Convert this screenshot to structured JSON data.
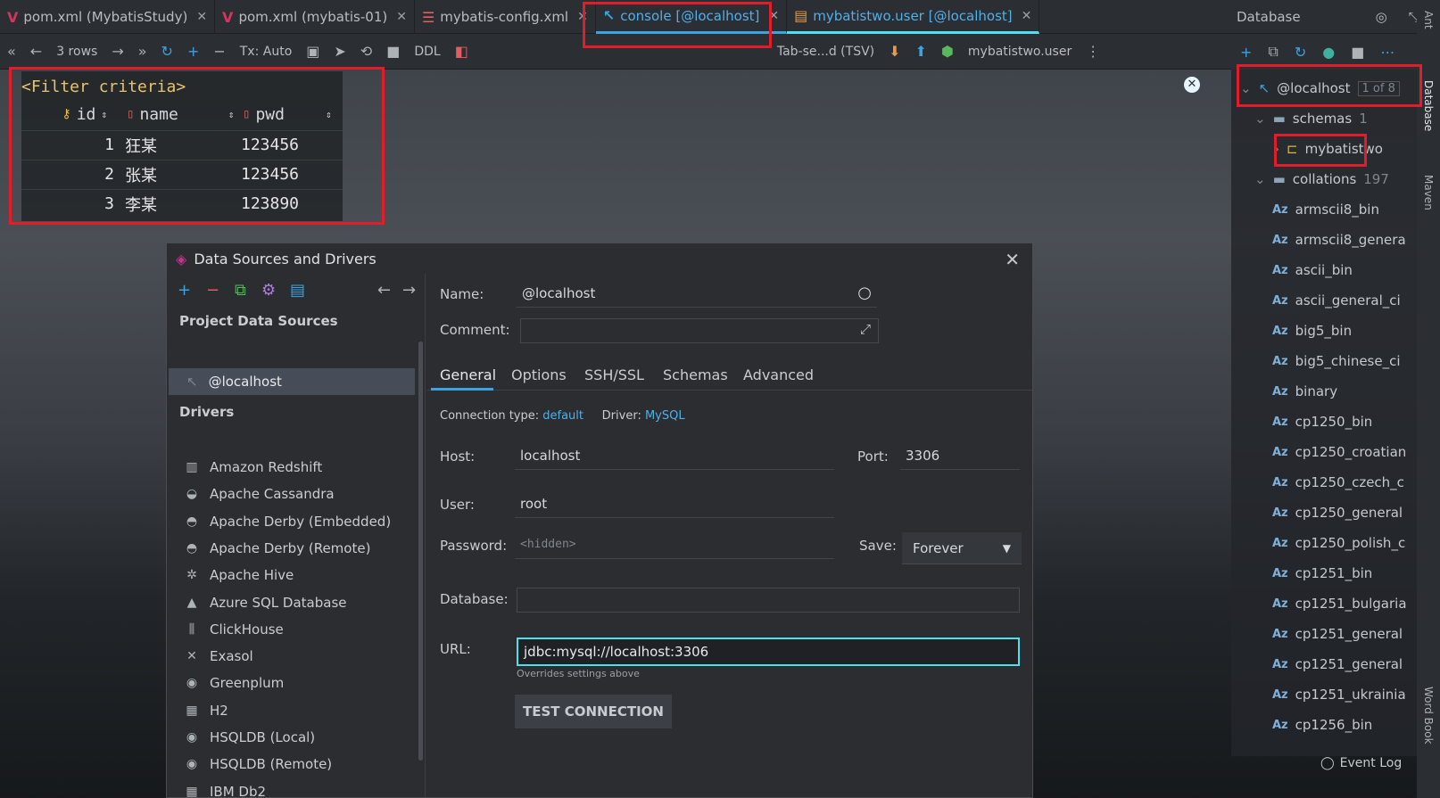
{
  "tabs": [
    {
      "label": "pom.xml (MybatisStudy)",
      "icon": "maven-icon"
    },
    {
      "label": "pom.xml (mybatis-01)",
      "icon": "maven-icon"
    },
    {
      "label": "mybatis-config.xml",
      "icon": "xml-icon"
    },
    {
      "label": "console [@localhost]",
      "icon": "console-icon"
    },
    {
      "label": "mybatistwo.user [@localhost]",
      "icon": "table-icon"
    }
  ],
  "database_panel": {
    "title": "Database"
  },
  "toolbar": {
    "rows": "3 rows",
    "tx": "Tx: Auto",
    "ddl": "DDL",
    "export_format": "Tab-se...d (TSV)",
    "target": "mybatistwo.user"
  },
  "grid": {
    "filter": "<Filter criteria>",
    "columns": [
      "id",
      "name",
      "pwd"
    ],
    "rows": [
      [
        "1",
        "狂某",
        "123456"
      ],
      [
        "2",
        "张某",
        "123456"
      ],
      [
        "3",
        "李某",
        "123890"
      ]
    ]
  },
  "tree": {
    "root": "@localhost",
    "root_count": "1 of 8",
    "schemas": "schemas",
    "schemas_count": "1",
    "schema": "mybatistwo",
    "collations": "collations",
    "collations_count": "197",
    "items": [
      "armscii8_bin",
      "armscii8_genera",
      "ascii_bin",
      "ascii_general_ci",
      "big5_bin",
      "big5_chinese_ci",
      "binary",
      "cp1250_bin",
      "cp1250_croatian",
      "cp1250_czech_c",
      "cp1250_general",
      "cp1250_polish_c",
      "cp1251_bin",
      "cp1251_bulgaria",
      "cp1251_general",
      "cp1251_general",
      "cp1251_ukrainia",
      "cp1256_bin"
    ]
  },
  "sidebar": {
    "ant": "Ant",
    "database": "Database",
    "maven": "Maven",
    "wordbook": "Word Book"
  },
  "event_log": "Event Log",
  "dialog": {
    "title": "Data Sources and Drivers",
    "project_sources_header": "Project Data Sources",
    "selected_source": "@localhost",
    "drivers_header": "Drivers",
    "drivers": [
      "Amazon Redshift",
      "Apache Cassandra",
      "Apache Derby (Embedded)",
      "Apache Derby (Remote)",
      "Apache Hive",
      "Azure SQL Database",
      "ClickHouse",
      "Exasol",
      "Greenplum",
      "H2",
      "HSQLDB (Local)",
      "HSQLDB (Remote)",
      "IBM Db2"
    ],
    "name_label": "Name:",
    "name_value": "@localhost",
    "comment_label": "Comment:",
    "tabs": [
      "General",
      "Options",
      "SSH/SSL",
      "Schemas",
      "Advanced"
    ],
    "conn_type_label": "Connection type:",
    "conn_type": "default",
    "driver_label": "Driver:",
    "driver": "MySQL",
    "host_label": "Host:",
    "host": "localhost",
    "port_label": "Port:",
    "port": "3306",
    "user_label": "User:",
    "user": "root",
    "password_label": "Password:",
    "password": "<hidden>",
    "save_label": "Save:",
    "save": "Forever",
    "database_label": "Database:",
    "url_label": "URL:",
    "url": "jdbc:mysql://localhost:3306",
    "url_hint": "Overrides settings above",
    "test_button": "TEST CONNECTION"
  }
}
